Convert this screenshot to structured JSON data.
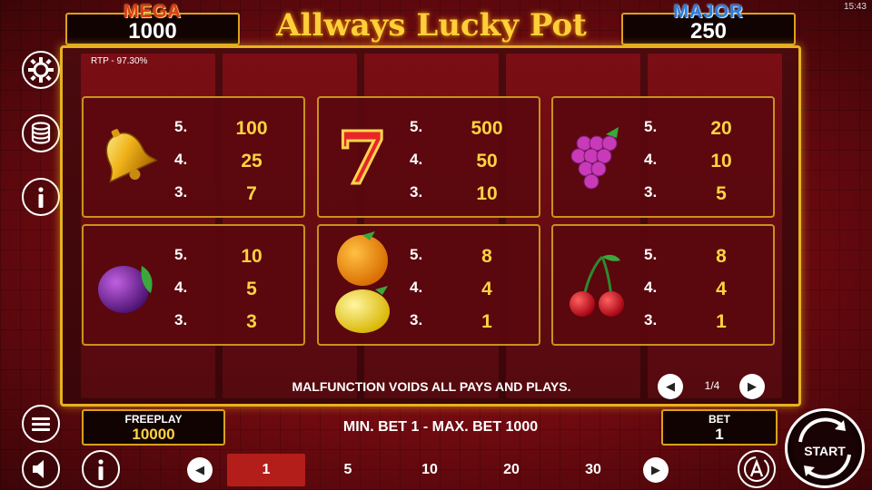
{
  "status": {
    "clock": "15:43"
  },
  "jackpots": {
    "mega": {
      "label": "MEGA",
      "value": "1000"
    },
    "major": {
      "label": "MAJOR",
      "value": "250"
    }
  },
  "title": "Allways Lucky Pot",
  "rtp": "RTP - 97.30%",
  "paytable": [
    {
      "symbol": "bell-icon",
      "rows": [
        {
          "count": "5.",
          "pay": "100"
        },
        {
          "count": "4.",
          "pay": "25"
        },
        {
          "count": "3.",
          "pay": "7"
        }
      ]
    },
    {
      "symbol": "seven-icon",
      "rows": [
        {
          "count": "5.",
          "pay": "500"
        },
        {
          "count": "4.",
          "pay": "50"
        },
        {
          "count": "3.",
          "pay": "10"
        }
      ]
    },
    {
      "symbol": "grapes-icon",
      "rows": [
        {
          "count": "5.",
          "pay": "20"
        },
        {
          "count": "4.",
          "pay": "10"
        },
        {
          "count": "3.",
          "pay": "5"
        }
      ]
    },
    {
      "symbol": "plum-icon",
      "rows": [
        {
          "count": "5.",
          "pay": "10"
        },
        {
          "count": "4.",
          "pay": "5"
        },
        {
          "count": "3.",
          "pay": "3"
        }
      ]
    },
    {
      "symbol": "orange-lemon-icon",
      "rows": [
        {
          "count": "5.",
          "pay": "8"
        },
        {
          "count": "4.",
          "pay": "4"
        },
        {
          "count": "3.",
          "pay": "1"
        }
      ]
    },
    {
      "symbol": "cherry-icon",
      "rows": [
        {
          "count": "5.",
          "pay": "8"
        },
        {
          "count": "4.",
          "pay": "4"
        },
        {
          "count": "3.",
          "pay": "1"
        }
      ]
    }
  ],
  "seven_glyph": "7",
  "malfunction": "MALFUNCTION VOIDS ALL PAYS AND PLAYS.",
  "pagination": {
    "label": "1/4",
    "prev_glyph": "◀",
    "next_glyph": "▶"
  },
  "freeplay": {
    "label": "FREEPLAY",
    "value": "10000"
  },
  "bet_limits": "MIN. BET 1 - MAX. BET 1000",
  "bet": {
    "label": "BET",
    "value": "1"
  },
  "bet_options": [
    "1",
    "5",
    "10",
    "20",
    "30"
  ],
  "bet_nav": {
    "prev_glyph": "◀",
    "next_glyph": "▶"
  },
  "start_label": "START",
  "icons": {
    "side": [
      "gear-icon",
      "coins-stack-icon",
      "info-icon",
      "menu-icon"
    ],
    "bottom": [
      "speaker-icon",
      "info-icon",
      "autoplay-icon"
    ]
  },
  "colors": {
    "gold": "#d9a21b",
    "pay_value": "#ffd341",
    "panel": "#5a080e",
    "selected_bet": "#b31e1b"
  }
}
